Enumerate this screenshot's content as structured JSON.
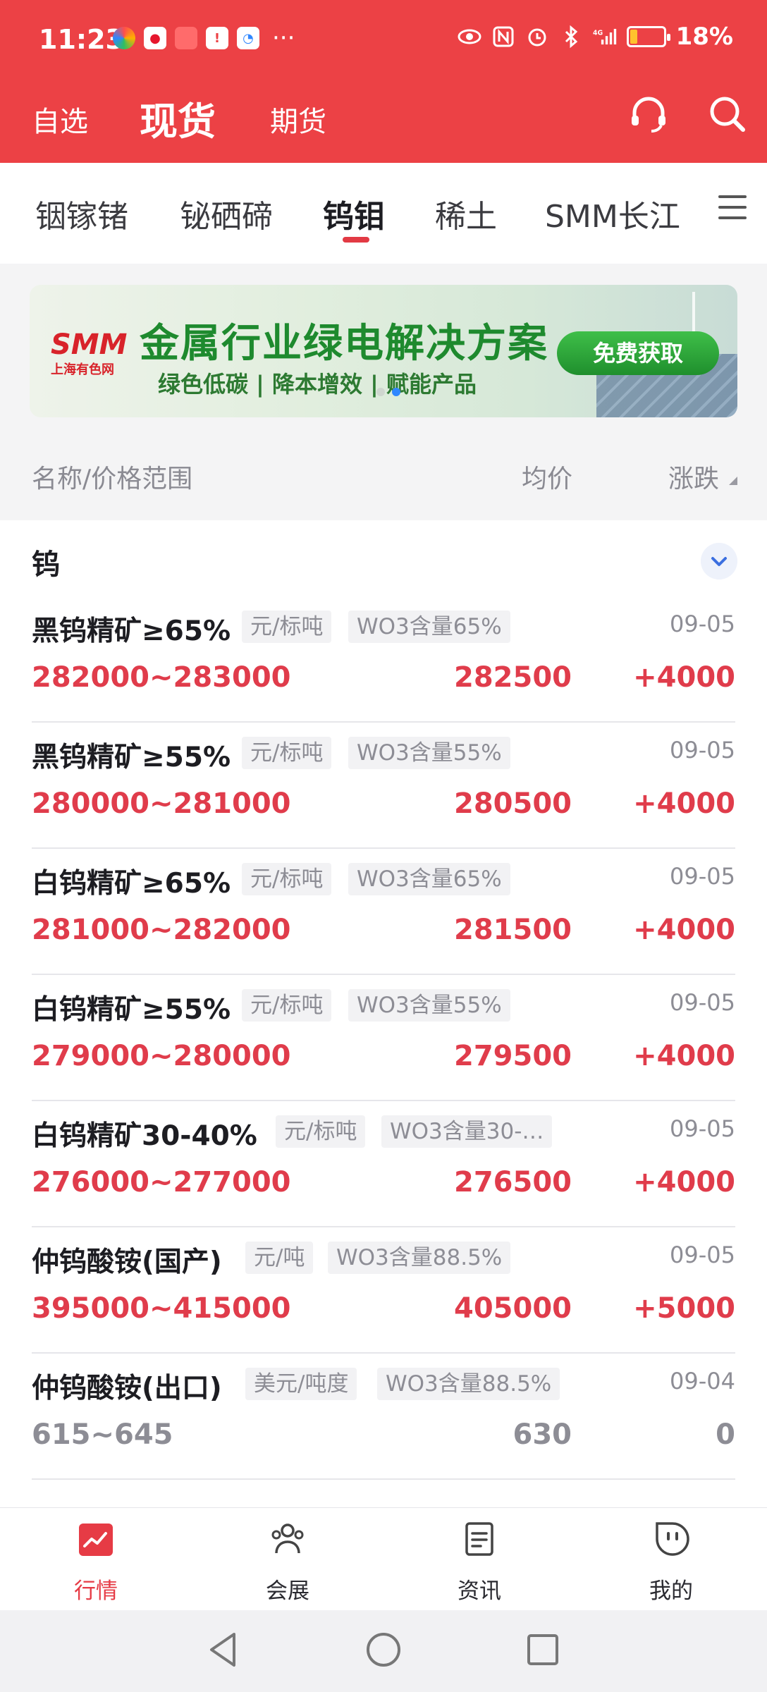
{
  "status_bar": {
    "time": "11:23",
    "battery": "18%",
    "more": "···",
    "network": "4G"
  },
  "top_nav": {
    "tab_watchlist": "自选",
    "tab_spot": "现货",
    "tab_futures": "期货"
  },
  "categories": [
    {
      "label": "铟镓锗"
    },
    {
      "label": "铋硒碲"
    },
    {
      "label": "钨钼"
    },
    {
      "label": "稀土"
    },
    {
      "label": "SMM长江"
    }
  ],
  "banner": {
    "logo": "SMM",
    "logo_sub": "上海有色网",
    "title": "金属行业绿电解决方案",
    "subtitle": "绿色低碳 | 降本增效 | 赋能产品",
    "cta": "免费获取"
  },
  "column_header": {
    "name": "名称/价格范围",
    "avg": "均价",
    "change": "涨跌"
  },
  "section_title": "钨",
  "rows": [
    {
      "name": "黑钨精矿≥65%",
      "unit": "元/标吨",
      "spec": "WO3含量65%",
      "date": "09-05",
      "range": "282000~283000",
      "avg": "282500",
      "change": "+4000"
    },
    {
      "name": "黑钨精矿≥55%",
      "unit": "元/标吨",
      "spec": "WO3含量55%",
      "date": "09-05",
      "range": "280000~281000",
      "avg": "280500",
      "change": "+4000"
    },
    {
      "name": "白钨精矿≥65%",
      "unit": "元/标吨",
      "spec": "WO3含量65%",
      "date": "09-05",
      "range": "281000~282000",
      "avg": "281500",
      "change": "+4000"
    },
    {
      "name": "白钨精矿≥55%",
      "unit": "元/标吨",
      "spec": "WO3含量55%",
      "date": "09-05",
      "range": "279000~280000",
      "avg": "279500",
      "change": "+4000"
    },
    {
      "name": "白钨精矿30-40%",
      "unit": "元/标吨",
      "spec": "WO3含量30-…",
      "date": "09-05",
      "range": "276000~277000",
      "avg": "276500",
      "change": "+4000"
    },
    {
      "name": "仲钨酸铵(国产)",
      "unit": "元/吨",
      "spec": "WO3含量88.5%",
      "date": "09-05",
      "range": "395000~415000",
      "avg": "405000",
      "change": "+5000"
    },
    {
      "name": "仲钨酸铵(出口)",
      "unit": "美元/吨度",
      "spec": "WO3含量88.5%",
      "date": "09-04",
      "range": "615~645",
      "avg": "630",
      "change": "0"
    }
  ],
  "bottom_nav": [
    {
      "label": "行情",
      "icon": "chart-trend-icon",
      "active": true
    },
    {
      "label": "会展",
      "icon": "people-icon",
      "active": false
    },
    {
      "label": "资讯",
      "icon": "document-icon",
      "active": false
    },
    {
      "label": "我的",
      "icon": "profile-icon",
      "active": false
    }
  ],
  "colors": {
    "brand_red": "#ec4145",
    "price_red": "#e03c4b",
    "neutral_gray": "#8d8d95"
  }
}
